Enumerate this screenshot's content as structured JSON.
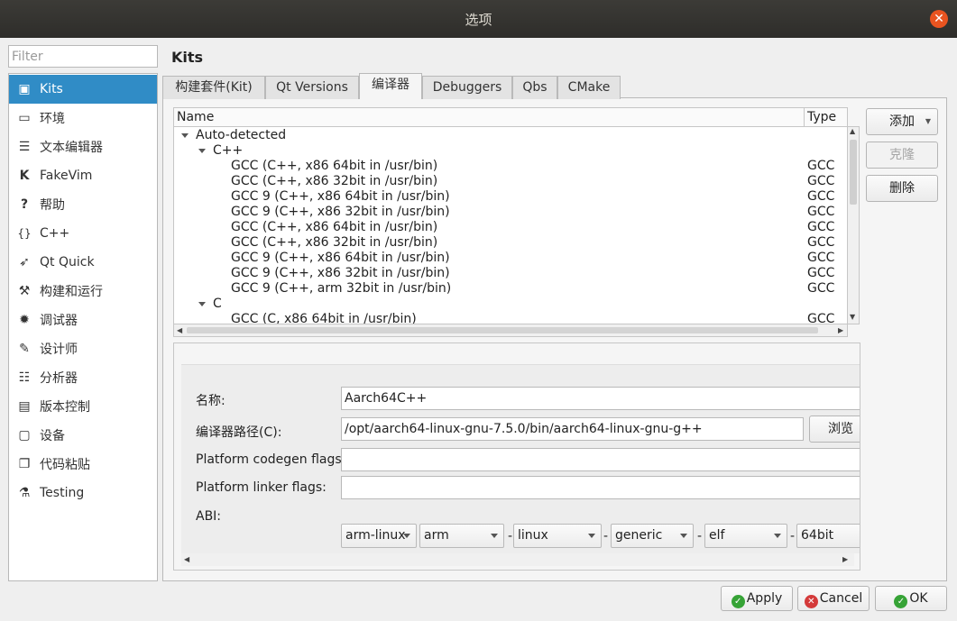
{
  "window": {
    "title": "选项"
  },
  "filter": {
    "placeholder": "Filter"
  },
  "categories": [
    {
      "label": "Kits",
      "icon": "kits-icon",
      "glyph": "▣"
    },
    {
      "label": "环境",
      "icon": "monitor-icon",
      "glyph": "▭"
    },
    {
      "label": "文本编辑器",
      "icon": "text-editor-icon",
      "glyph": "☰"
    },
    {
      "label": "FakeVim",
      "icon": "fakevim-icon",
      "glyph": "K"
    },
    {
      "label": "帮助",
      "icon": "help-icon",
      "glyph": "?"
    },
    {
      "label": "C++",
      "icon": "braces-icon",
      "glyph": "{}"
    },
    {
      "label": "Qt Quick",
      "icon": "qt-quick-icon",
      "glyph": "➶"
    },
    {
      "label": "构建和运行",
      "icon": "hammer-icon",
      "glyph": "⚒"
    },
    {
      "label": "调试器",
      "icon": "bug-icon",
      "glyph": "✹"
    },
    {
      "label": "设计师",
      "icon": "pencil-icon",
      "glyph": "✎"
    },
    {
      "label": "分析器",
      "icon": "analyzer-icon",
      "glyph": "☷"
    },
    {
      "label": "版本控制",
      "icon": "version-control-icon",
      "glyph": "▤"
    },
    {
      "label": "设备",
      "icon": "device-icon",
      "glyph": "▢"
    },
    {
      "label": "代码粘贴",
      "icon": "code-paste-icon",
      "glyph": "❐"
    },
    {
      "label": "Testing",
      "icon": "testing-icon",
      "glyph": "⚗"
    }
  ],
  "page": {
    "title": "Kits"
  },
  "tabs": [
    "构建套件(Kit)",
    "Qt Versions",
    "编译器",
    "Debuggers",
    "Qbs",
    "CMake"
  ],
  "tree": {
    "headers": {
      "name": "Name",
      "type": "Type"
    },
    "rows": [
      {
        "name": "Auto-detected",
        "type": ""
      },
      {
        "name": "C++",
        "type": ""
      },
      {
        "name": "GCC (C++, x86 64bit in /usr/bin)",
        "type": "GCC"
      },
      {
        "name": "GCC (C++, x86 32bit in /usr/bin)",
        "type": "GCC"
      },
      {
        "name": "GCC 9 (C++, x86 64bit in /usr/bin)",
        "type": "GCC"
      },
      {
        "name": "GCC 9 (C++, x86 32bit in /usr/bin)",
        "type": "GCC"
      },
      {
        "name": "GCC (C++, x86 64bit in /usr/bin)",
        "type": "GCC"
      },
      {
        "name": "GCC (C++, x86 32bit in /usr/bin)",
        "type": "GCC"
      },
      {
        "name": "GCC 9 (C++, x86 64bit in /usr/bin)",
        "type": "GCC"
      },
      {
        "name": "GCC 9 (C++, x86 32bit in /usr/bin)",
        "type": "GCC"
      },
      {
        "name": "GCC 9 (C++, arm 32bit in /usr/bin)",
        "type": "GCC"
      },
      {
        "name": "C",
        "type": ""
      },
      {
        "name": "GCC (C, x86 64bit in /usr/bin)",
        "type": "GCC"
      }
    ]
  },
  "actions": {
    "add": "添加",
    "clone": "克隆",
    "remove": "删除"
  },
  "details": {
    "name_label": "名称:",
    "name_value": "Aarch64C++",
    "path_label": "编译器路径(C):",
    "path_value": "/opt/aarch64-linux-gnu-7.5.0/bin/aarch64-linux-gnu-g++",
    "browse": "浏览",
    "codegen_label": "Platform codegen flags:",
    "codegen_value": "",
    "linker_label": "Platform linker flags:",
    "linker_value": "",
    "abi_label": "ABI:",
    "abi": [
      "arm-linux",
      "arm",
      "linux",
      "generic",
      "elf",
      "64bit"
    ]
  },
  "footer": {
    "apply": "Apply",
    "cancel": "Cancel",
    "ok": "OK"
  },
  "colors": {
    "selection": "#308cc6",
    "close_button": "#e95420"
  }
}
